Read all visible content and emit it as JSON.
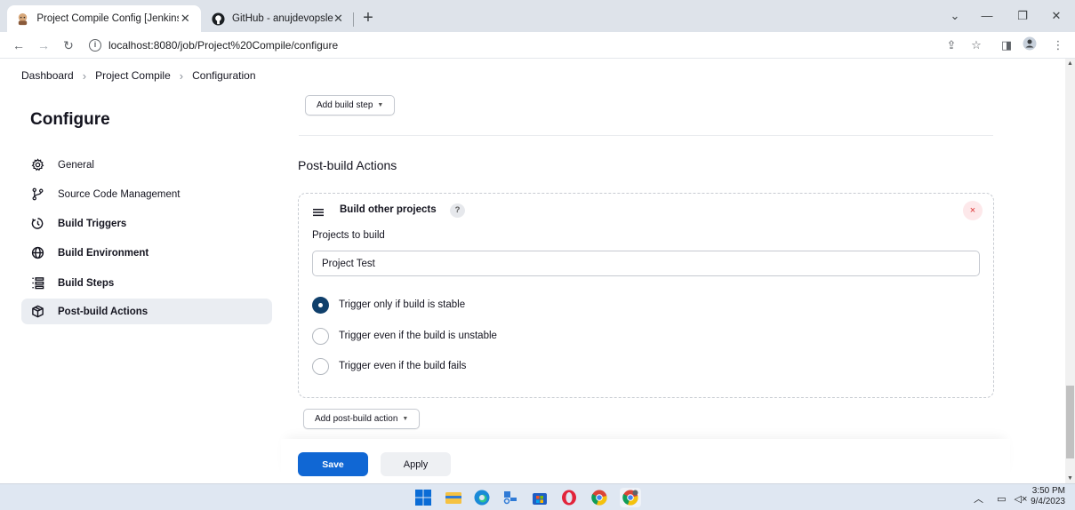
{
  "browser": {
    "tabs": [
      {
        "title": "Project Compile Config [Jenkins]",
        "icon": "jenkins-icon",
        "active": true
      },
      {
        "title": "GitHub - anujdevopslearn/Maver",
        "icon": "github-icon",
        "active": false
      }
    ],
    "url": "localhost:8080/job/Project%20Compile/configure"
  },
  "breadcrumb": [
    "Dashboard",
    "Project Compile",
    "Configuration"
  ],
  "sidebar": {
    "title": "Configure",
    "items": [
      {
        "label": "General",
        "icon": "gear-icon"
      },
      {
        "label": "Source Code Management",
        "icon": "branch-icon"
      },
      {
        "label": "Build Triggers",
        "icon": "clock-icon"
      },
      {
        "label": "Build Environment",
        "icon": "globe-icon"
      },
      {
        "label": "Build Steps",
        "icon": "list-icon"
      },
      {
        "label": "Post-build Actions",
        "icon": "cube-icon"
      }
    ]
  },
  "main": {
    "add_build_step": "Add build step",
    "post_build_title": "Post-build Actions",
    "card": {
      "title": "Build other projects",
      "help": "?",
      "remove": "×",
      "projects_label": "Projects to build",
      "projects_value": "Project Test",
      "options": [
        {
          "label": "Trigger only if build is stable",
          "checked": true
        },
        {
          "label": "Trigger even if the build is unstable",
          "checked": false
        },
        {
          "label": "Trigger even if the build fails",
          "checked": false
        }
      ]
    },
    "add_post_build": "Add post-build action",
    "save": "Save",
    "apply": "Apply"
  },
  "taskbar": {
    "time": "3:50 PM",
    "date": "9/4/2023"
  },
  "colors": {
    "primary": "#1067d4",
    "radio_checked": "#0f3f6b",
    "remove": "#d33333"
  }
}
